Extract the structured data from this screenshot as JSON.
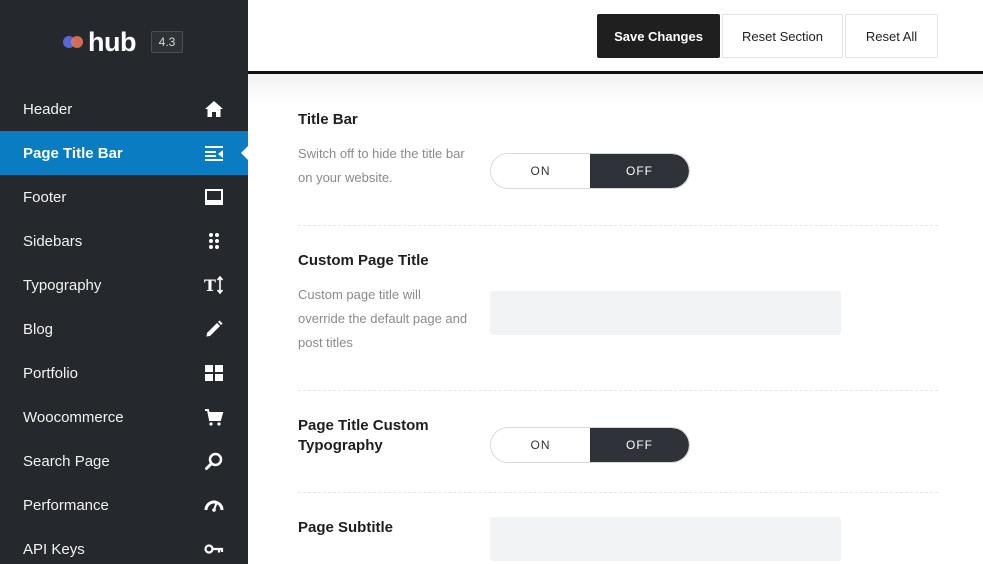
{
  "brand": {
    "name": "hub",
    "version": "4.3",
    "colors": {
      "dot1": "#5668d8",
      "dot2": "#e2725b"
    }
  },
  "sidebar": {
    "active_color": "#0a7dc2",
    "items": [
      {
        "label": "Header",
        "icon": "home-icon",
        "active": false
      },
      {
        "label": "Page Title Bar",
        "icon": "title-bar-icon",
        "active": true
      },
      {
        "label": "Footer",
        "icon": "footer-icon",
        "active": false
      },
      {
        "label": "Sidebars",
        "icon": "grid-dots-icon",
        "active": false
      },
      {
        "label": "Typography",
        "icon": "typography-icon",
        "active": false
      },
      {
        "label": "Blog",
        "icon": "pencil-icon",
        "active": false
      },
      {
        "label": "Portfolio",
        "icon": "portfolio-grid-icon",
        "active": false
      },
      {
        "label": "Woocommerce",
        "icon": "cart-icon",
        "active": false
      },
      {
        "label": "Search Page",
        "icon": "search-icon",
        "active": false
      },
      {
        "label": "Performance",
        "icon": "gauge-icon",
        "active": false
      },
      {
        "label": "API Keys",
        "icon": "key-icon",
        "active": false
      }
    ]
  },
  "toolbar": {
    "save_label": "Save Changes",
    "reset_section_label": "Reset Section",
    "reset_all_label": "Reset All"
  },
  "settings": {
    "title_bar": {
      "title": "Title Bar",
      "description": "Switch off to hide the title bar on your website.",
      "on_label": "ON",
      "off_label": "OFF",
      "value": "OFF"
    },
    "custom_page_title": {
      "title": "Custom Page Title",
      "description": "Custom page title will override the default page and post titles",
      "value": ""
    },
    "custom_typography": {
      "title": "Page Title Custom Typography",
      "on_label": "ON",
      "off_label": "OFF",
      "value": "OFF"
    },
    "page_subtitle": {
      "title": "Page Subtitle",
      "value": ""
    }
  }
}
